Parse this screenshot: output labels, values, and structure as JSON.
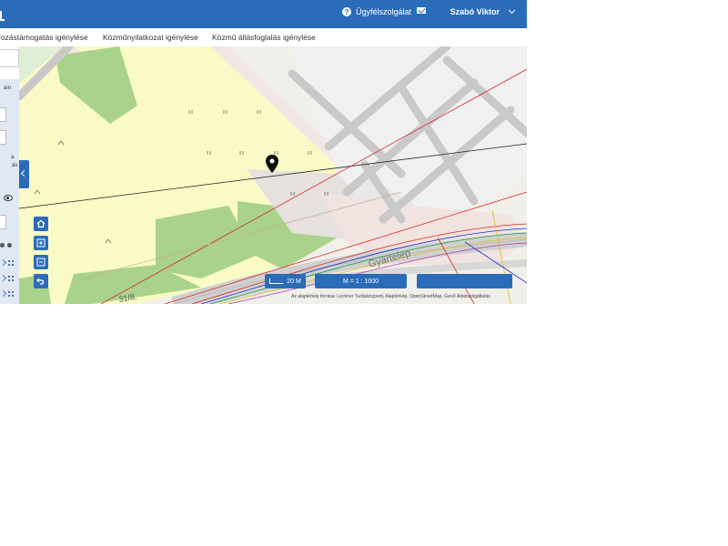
{
  "header": {
    "help_label": "Ügyfélszolgálat",
    "user_name": "Szabó Viktor"
  },
  "tabs": [
    {
      "label": "rozástámogatás igénylése"
    },
    {
      "label": "Közműnyilatkozat igénylése"
    },
    {
      "label": "Közmű állásfoglalás igénylése"
    }
  ],
  "sidebar": {
    "texts": [
      "ain",
      "a",
      "ás"
    ]
  },
  "map": {
    "street_label": "Gyártelep",
    "parcel_label": "31/8.",
    "scale_label": "20 M",
    "ratio_label": "M = 1 : 1000",
    "attribution": "Az alaptérkép forrása: Lechner Tudásközpont, Alaptérkép, OpenStreetMap, GeoX Adatszolgáltatás"
  },
  "colors": {
    "primary": "#2b6cb8",
    "parcel_yellow": "#fafac6",
    "green": "#a9d38a",
    "road": "#c9c9c9"
  },
  "icons": [
    "help-icon",
    "mail-icon",
    "chevron-down-icon",
    "home-icon",
    "zoom-in-icon",
    "zoom-out-icon",
    "back-icon",
    "map-pin-icon",
    "eye-icon"
  ]
}
